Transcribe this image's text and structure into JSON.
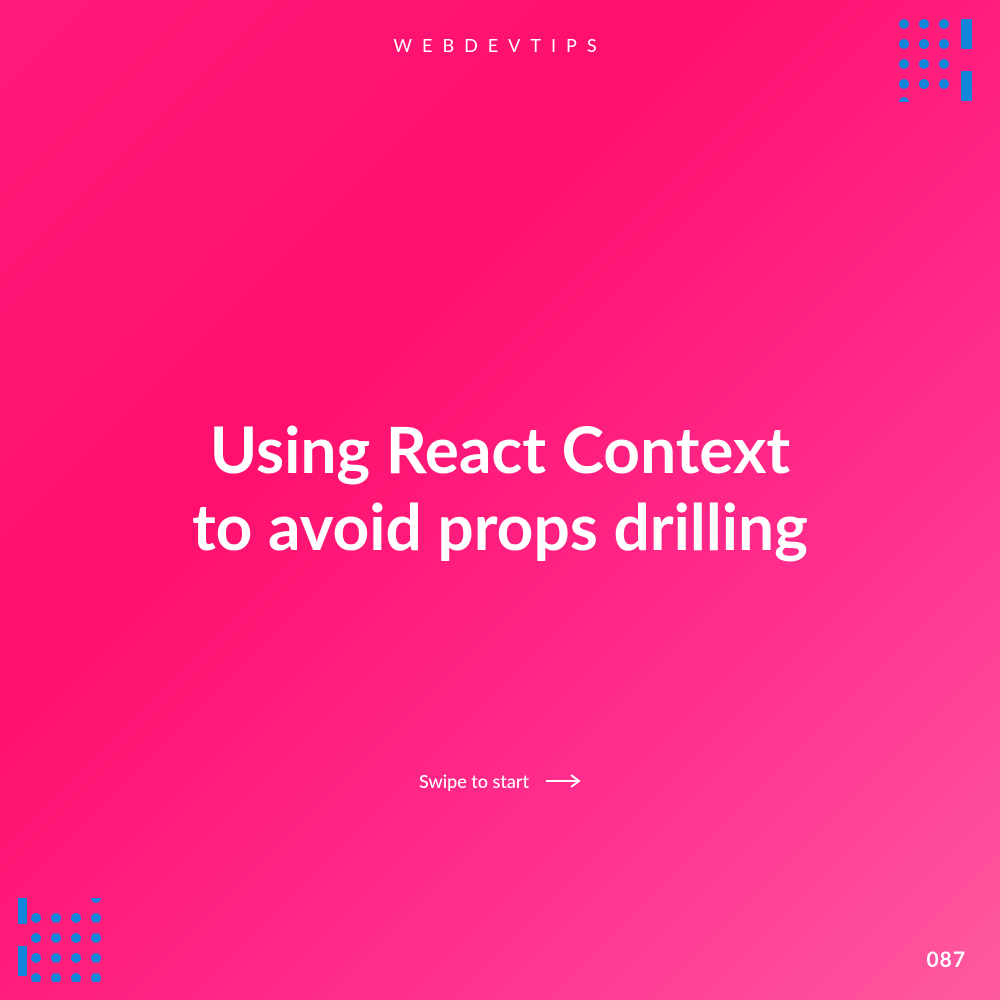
{
  "header": {
    "label": "WEBDEVTIPS"
  },
  "main": {
    "title_line1": "Using React Context",
    "title_line2": "to avoid props drilling"
  },
  "cta": {
    "text": "Swipe to start"
  },
  "slide_number": "087",
  "colors": {
    "accent_blue": "#1185d9",
    "bg_gradient_start": "#ff1a7a",
    "bg_gradient_end": "#ff5aa0"
  }
}
